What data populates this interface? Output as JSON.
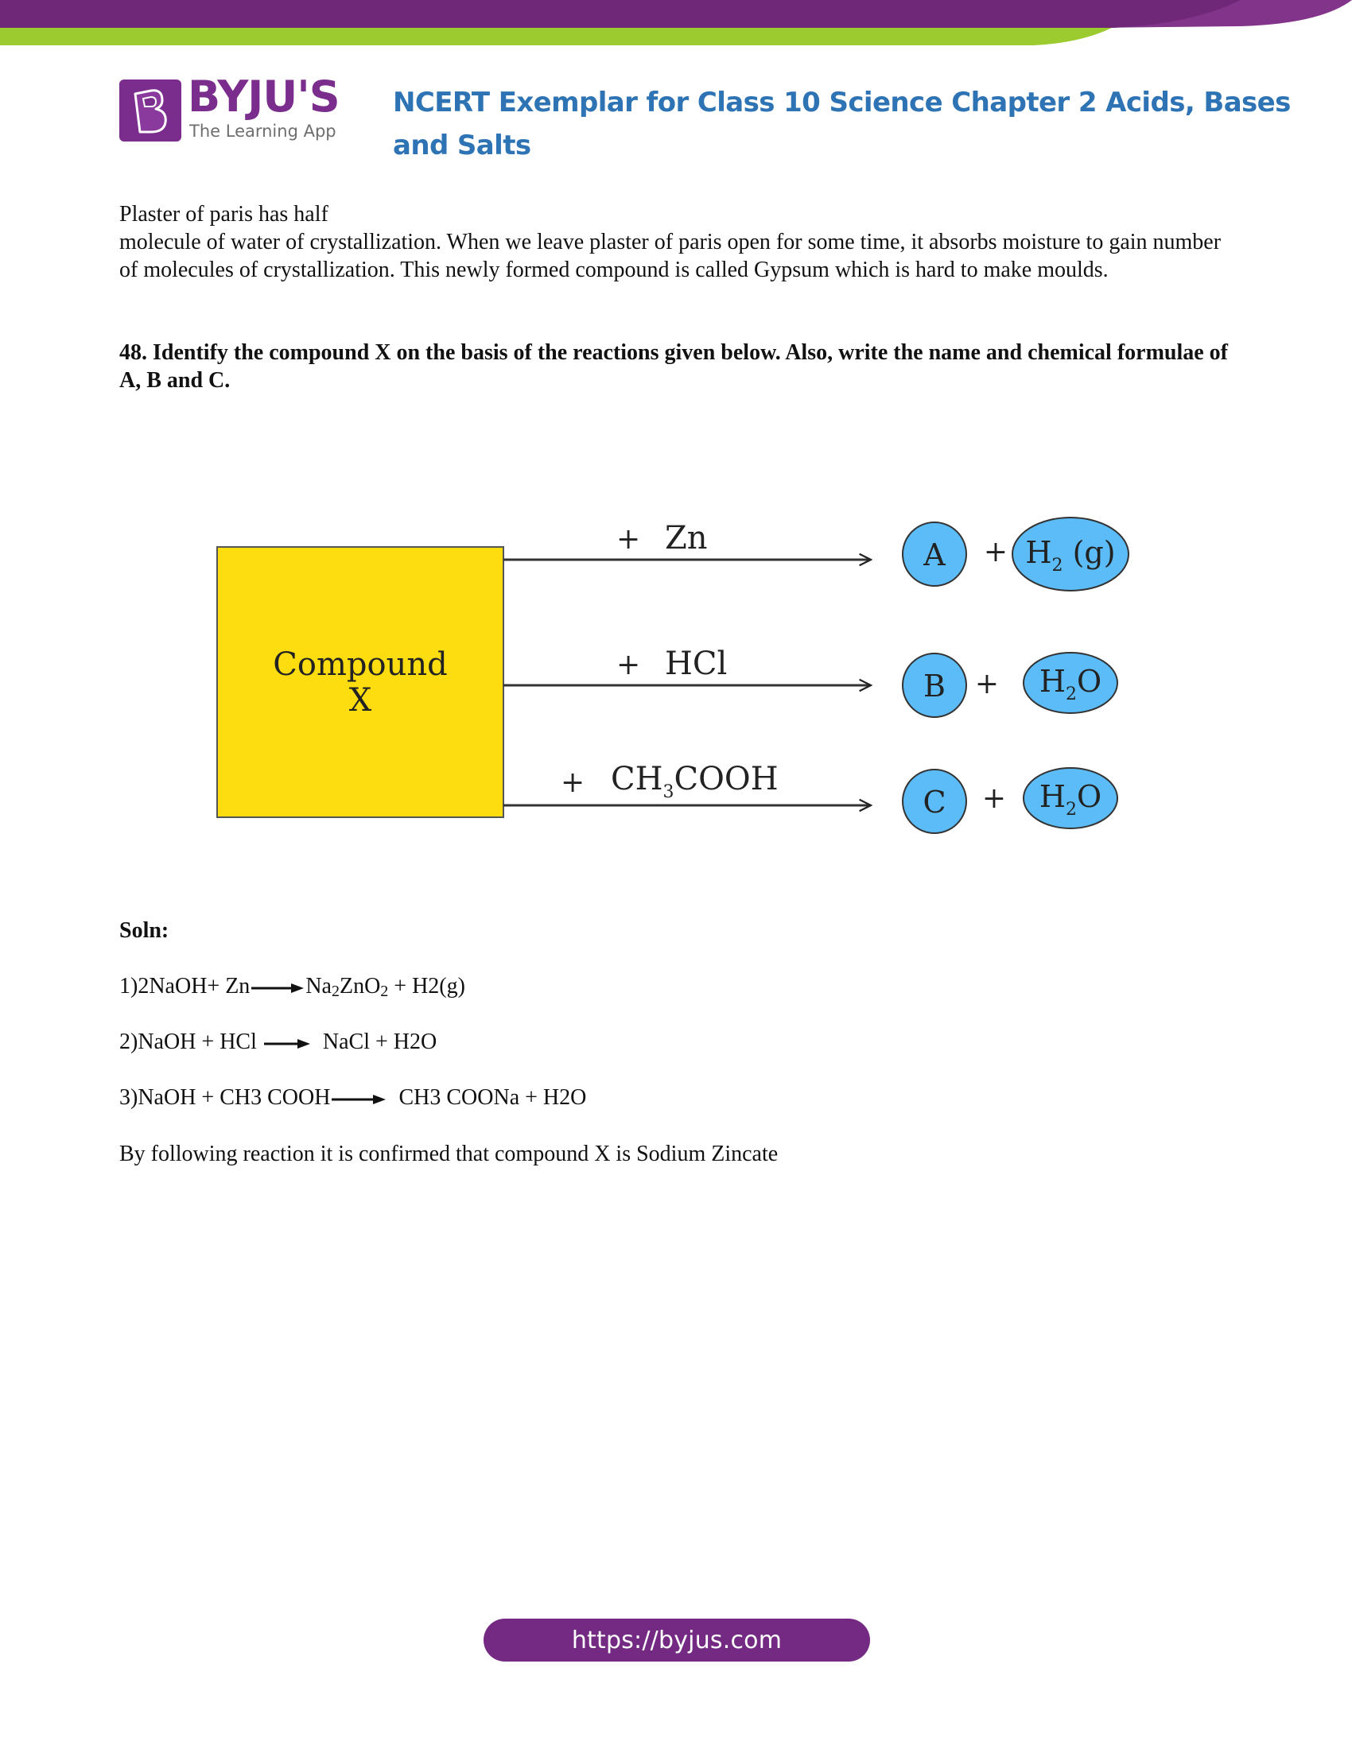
{
  "header": {
    "brand_name": "BYJU'S",
    "brand_tagline": "The Learning App",
    "doc_title": "NCERT Exemplar for Class 10 Science Chapter 2 Acids, Bases and Salts",
    "colors": {
      "banner_purple": "#6f2878",
      "banner_green": "#9ccb2f",
      "title_blue": "#2e74b5",
      "logo_purple": "#7a2d8c"
    }
  },
  "content": {
    "paragraph_line1": "Plaster of paris has half",
    "paragraph_rest": "molecule of water of crystallization. When we leave plaster of paris open for some time, it absorbs moisture to gain number of molecules of crystallization. This newly formed compound is called Gypsum which is hard to make moulds.",
    "question": "48. Identify the compound X on the basis of the reactions given below. Also, write the name and chemical formulae of A, B and C."
  },
  "diagram": {
    "compound_label_line1": "Compound",
    "compound_label_line2": "X",
    "colors": {
      "compound_fill": "#fddc10",
      "product_fill": "#5bbcf8"
    },
    "reactions": [
      {
        "reagent_plus": "+",
        "reagent": "Zn",
        "reagent_sub": "",
        "reagent_tail": "",
        "product": "A",
        "plus": "+",
        "byproduct_main": "H",
        "byproduct_sub": "2",
        "byproduct_tail": " (g)"
      },
      {
        "reagent_plus": "+",
        "reagent": "HCl",
        "reagent_sub": "",
        "reagent_tail": "",
        "product": "B",
        "plus": "+",
        "byproduct_main": "H",
        "byproduct_sub": "2",
        "byproduct_tail": "O"
      },
      {
        "reagent_plus": "+",
        "reagent": "CH",
        "reagent_sub": "3",
        "reagent_tail": "COOH",
        "product": "C",
        "plus": "+",
        "byproduct_main": "H",
        "byproduct_sub": "2",
        "byproduct_tail": "O"
      }
    ]
  },
  "solution": {
    "heading": "Soln:",
    "equations": [
      {
        "left": "1)2NaOH+ Zn",
        "right_a": "Na",
        "right_sub1": "2",
        "right_b": "ZnO",
        "right_sub2": "2",
        "right_c": " + H2(g)"
      },
      {
        "left": "2)NaOH + HCl",
        "right": "NaCl + H2O"
      },
      {
        "left": "3)NaOH + CH3 COOH",
        "right": "CH3 COONa + H2O"
      }
    ],
    "conclusion": "By following reaction it is confirmed that compound X is Sodium Zincate"
  },
  "footer": {
    "url_label": "https://byjus.com"
  }
}
